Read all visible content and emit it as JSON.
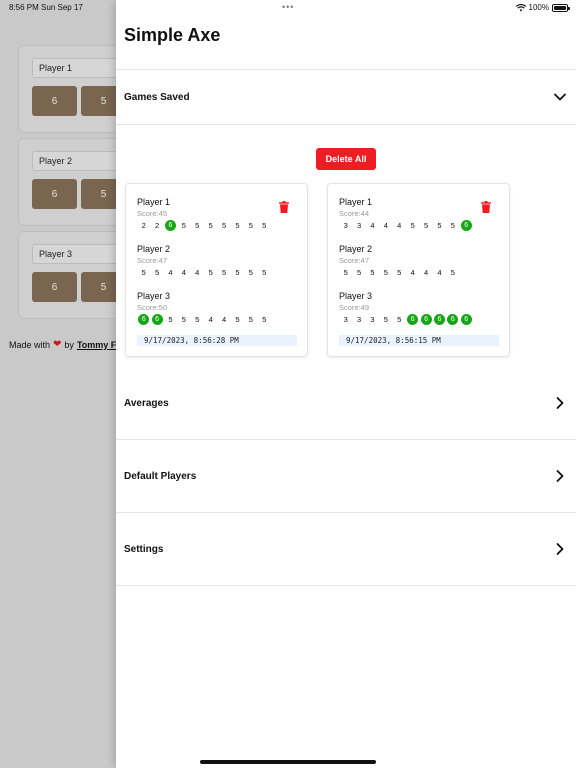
{
  "status_bar": {
    "time": "8:56 PM",
    "date": "Sun Sep 17",
    "battery": "100%",
    "multitask_dots": "•••"
  },
  "background": {
    "cards": [
      {
        "player": "Player 1",
        "buttons": [
          "6",
          "5"
        ]
      },
      {
        "player": "Player 2",
        "buttons": [
          "6",
          "5"
        ]
      },
      {
        "player": "Player 3",
        "buttons": [
          "6",
          "5"
        ]
      }
    ],
    "made_with": "Made with",
    "by": "by",
    "author": "Tommy F"
  },
  "sheet": {
    "title": "Simple Axe",
    "games_saved_label": "Games Saved",
    "delete_all_label": "Delete All",
    "games": [
      {
        "players": [
          {
            "name": "Player 1",
            "score_label": "Score:45",
            "throws": [
              "2",
              "2",
              "6",
              "5",
              "5",
              "5",
              "5",
              "5",
              "5",
              "5"
            ]
          },
          {
            "name": "Player 2",
            "score_label": "Score:47",
            "throws": [
              "5",
              "5",
              "4",
              "4",
              "4",
              "5",
              "5",
              "5",
              "5",
              "5"
            ]
          },
          {
            "name": "Player 3",
            "score_label": "Score:50",
            "throws": [
              "6",
              "6",
              "5",
              "5",
              "5",
              "4",
              "4",
              "5",
              "5",
              "5"
            ]
          }
        ],
        "date": "9/17/2023, 8:56:28 PM"
      },
      {
        "players": [
          {
            "name": "Player 1",
            "score_label": "Score:44",
            "throws": [
              "3",
              "3",
              "4",
              "4",
              "4",
              "5",
              "5",
              "5",
              "5",
              "6"
            ]
          },
          {
            "name": "Player 2",
            "score_label": "Score:47",
            "throws": [
              "5",
              "5",
              "5",
              "5",
              "5",
              "4",
              "4",
              "4",
              "5"
            ]
          },
          {
            "name": "Player 3",
            "score_label": "Score:49",
            "throws": [
              "3",
              "3",
              "3",
              "5",
              "5",
              "6",
              "6",
              "6",
              "6",
              "6"
            ]
          }
        ],
        "date": "9/17/2023, 8:56:15 PM"
      }
    ],
    "sections": [
      {
        "label": "Averages",
        "icon": "chevron-right-icon"
      },
      {
        "label": "Default Players",
        "icon": "chevron-right-icon"
      },
      {
        "label": "Settings",
        "icon": "chevron-right-icon"
      }
    ]
  },
  "colors": {
    "accent_red": "#ee1c23",
    "bullseye_green": "#16a616",
    "button_brown": "#7a6550"
  }
}
